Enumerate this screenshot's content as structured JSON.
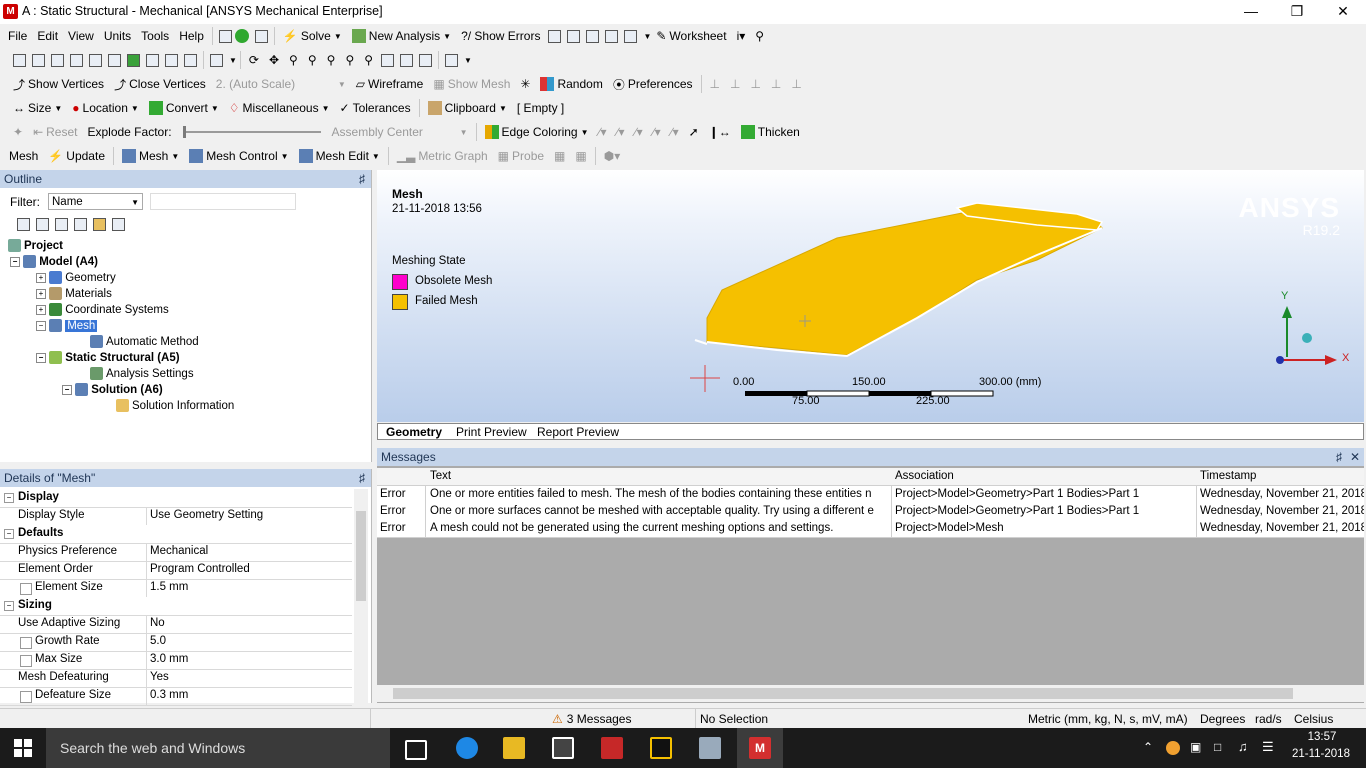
{
  "window": {
    "title": "A : Static Structural - Mechanical [ANSYS Mechanical Enterprise]",
    "app_icon": "M"
  },
  "menu": [
    "File",
    "Edit",
    "View",
    "Units",
    "Tools",
    "Help"
  ],
  "toolbar1": {
    "solve": "Solve",
    "new_analysis": "New Analysis",
    "show_errors": "?/ Show Errors",
    "worksheet": "Worksheet"
  },
  "toolbar3": {
    "show_vertices": "Show Vertices",
    "close_vertices": "Close Vertices",
    "auto_scale": "2. (Auto Scale)",
    "wireframe": "Wireframe",
    "show_mesh": "Show Mesh",
    "random": "Random",
    "preferences": "Preferences"
  },
  "toolbar4": {
    "size": "Size",
    "location": "Location",
    "convert": "Convert",
    "misc": "Miscellaneous",
    "tolerances": "Tolerances",
    "clipboard": "Clipboard",
    "empty": "[ Empty ]"
  },
  "toolbar5": {
    "reset": "Reset",
    "explode_factor": "Explode Factor:",
    "assembly_center": "Assembly Center",
    "edge_coloring": "Edge Coloring",
    "thicken": "Thicken"
  },
  "toolbar6": {
    "mesh": "Mesh",
    "update": "Update",
    "mesh_dd": "Mesh",
    "mesh_control": "Mesh Control",
    "mesh_edit": "Mesh Edit",
    "metric_graph": "Metric Graph",
    "probe": "Probe"
  },
  "outline": {
    "title": "Outline",
    "filter_label": "Filter:",
    "filter_value": "Name",
    "tree": [
      "Project",
      "Model (A4)",
      "Geometry",
      "Materials",
      "Coordinate Systems",
      "Mesh",
      "Automatic Method",
      "Static Structural (A5)",
      "Analysis Settings",
      "Solution (A6)",
      "Solution Information"
    ]
  },
  "details": {
    "title": "Details of \"Mesh\"",
    "rows": [
      {
        "k": "Display",
        "v": "",
        "grp": true
      },
      {
        "k": "Display Style",
        "v": "Use Geometry Setting"
      },
      {
        "k": "Defaults",
        "v": "",
        "grp": true
      },
      {
        "k": "Physics Preference",
        "v": "Mechanical"
      },
      {
        "k": "Element Order",
        "v": "Program Controlled"
      },
      {
        "k": "Element Size",
        "v": "1.5 mm",
        "cb": true
      },
      {
        "k": "Sizing",
        "v": "",
        "grp": true
      },
      {
        "k": "Use Adaptive Sizing",
        "v": "No"
      },
      {
        "k": "Growth Rate",
        "v": "5.0",
        "cb": true
      },
      {
        "k": "Max Size",
        "v": "3.0 mm",
        "cb": true
      },
      {
        "k": "Mesh Defeaturing",
        "v": "Yes"
      },
      {
        "k": "Defeature Size",
        "v": "0.3 mm",
        "cb": true
      }
    ]
  },
  "viewport": {
    "heading": "Mesh",
    "date": "21-11-2018 13:56",
    "legend_title": "Meshing State",
    "legend": [
      {
        "label": "Obsolete Mesh",
        "color": "#ff00cc"
      },
      {
        "label": "Failed Mesh",
        "color": "#f5c000"
      }
    ],
    "brand": "ANSYS",
    "version": "R19.2",
    "scale": {
      "t0": "0.00",
      "t150": "150.00",
      "t300": "300.00 (mm)",
      "t75": "75.00",
      "t225": "225.00"
    },
    "axes": {
      "x": "X",
      "y": "Y"
    },
    "tabs": [
      "Geometry",
      "Print Preview",
      "Report Preview"
    ]
  },
  "messages": {
    "title": "Messages",
    "headers": [
      "Text",
      "Association",
      "Timestamp"
    ],
    "rows": [
      {
        "type": "Error",
        "text": "One or more entities failed to mesh. The mesh of the bodies containing these entities n",
        "assoc": "Project>Model>Geometry>Part 1 Bodies>Part 1",
        "time": "Wednesday, November 21, 2018"
      },
      {
        "type": "Error",
        "text": "One or more surfaces cannot be meshed with acceptable quality. Try using a different e",
        "assoc": "Project>Model>Geometry>Part 1 Bodies>Part 1",
        "time": "Wednesday, November 21, 2018"
      },
      {
        "type": "Error",
        "text": "A mesh could not be generated using the current meshing options and settings.",
        "assoc": "Project>Model>Mesh",
        "time": "Wednesday, November 21, 2018"
      }
    ]
  },
  "status": {
    "messages": "3 Messages",
    "selection": "No Selection",
    "units": "Metric (mm, kg, N, s, mV, mA)",
    "degrees": "Degrees",
    "rads": "rad/s",
    "temp": "Celsius"
  },
  "taskbar": {
    "search": "Search the web and Windows",
    "time": "13:57",
    "date": "21-11-2018"
  }
}
